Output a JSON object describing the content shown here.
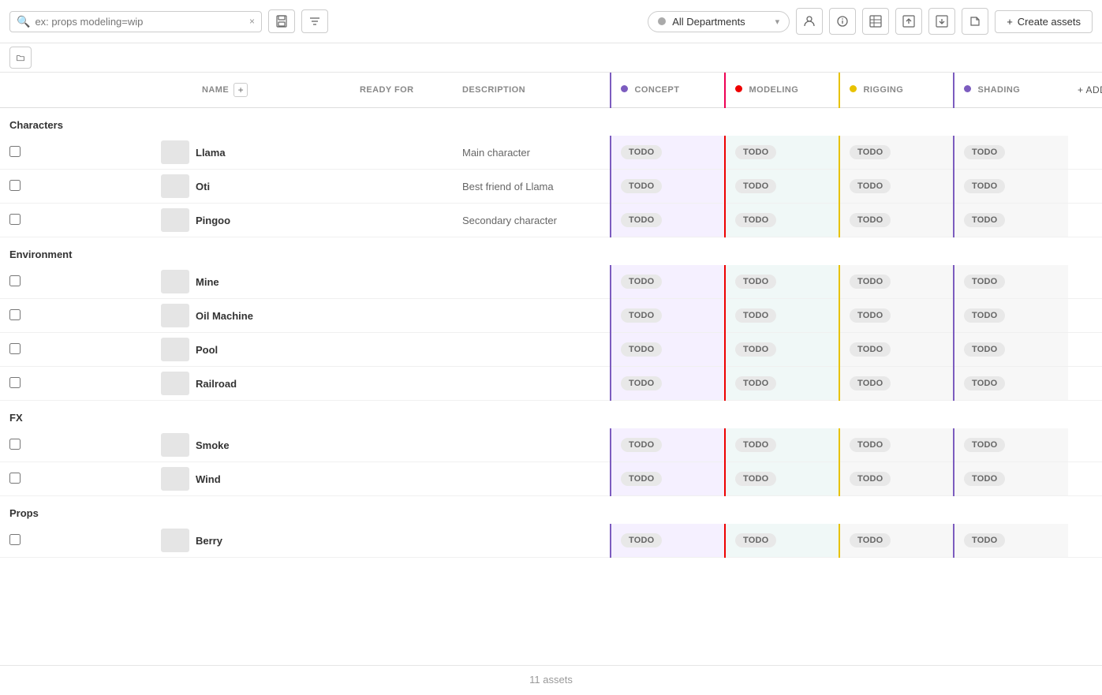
{
  "toolbar": {
    "search_placeholder": "ex: props modeling=wip",
    "clear_label": "×",
    "dept_label": "All Departments",
    "create_label": "Create assets",
    "create_prefix": "+"
  },
  "table": {
    "col_name": "NAME",
    "col_ready": "READY FOR",
    "col_desc": "DESCRIPTION",
    "col_concept": "Concept",
    "col_modeling": "Modeling",
    "col_rigging": "Rigging",
    "col_shading": "Shading",
    "add_tasks_label": "+ Add tasks"
  },
  "groups": [
    {
      "name": "Characters",
      "assets": [
        {
          "name": "Llama",
          "bold": true,
          "desc": "Main character"
        },
        {
          "name": "Oti",
          "bold": true,
          "desc": "Best friend of Llama"
        },
        {
          "name": "Pingoo",
          "bold": true,
          "desc": "Secondary character"
        }
      ]
    },
    {
      "name": "Environment",
      "assets": [
        {
          "name": "Mine",
          "bold": true,
          "desc": ""
        },
        {
          "name": "Oil Machine",
          "bold": true,
          "desc": ""
        },
        {
          "name": "Pool",
          "bold": true,
          "desc": ""
        },
        {
          "name": "Railroad",
          "bold": true,
          "desc": ""
        }
      ]
    },
    {
      "name": "FX",
      "assets": [
        {
          "name": "Smoke",
          "bold": true,
          "desc": ""
        },
        {
          "name": "Wind",
          "bold": true,
          "desc": ""
        }
      ]
    },
    {
      "name": "Props",
      "assets": [
        {
          "name": "Berry",
          "bold": true,
          "desc": ""
        }
      ]
    }
  ],
  "footer": {
    "count": "11 assets"
  }
}
